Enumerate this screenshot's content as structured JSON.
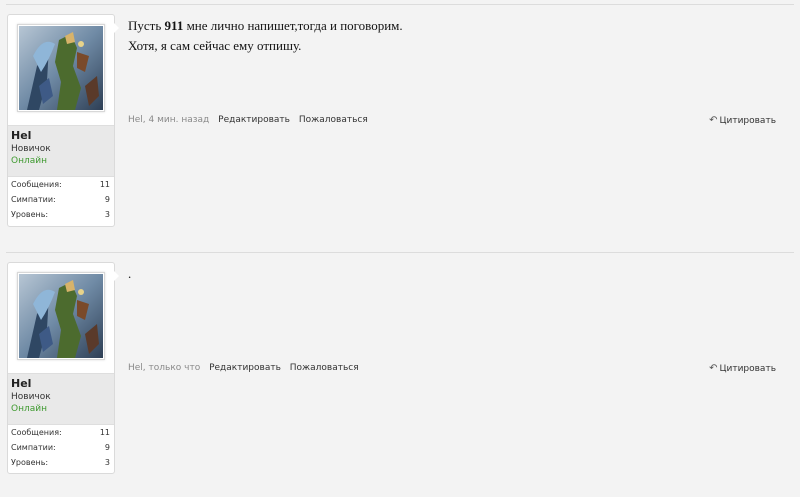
{
  "posts": [
    {
      "user": {
        "name": "Hel",
        "title": "Новичок",
        "status": "Онлайн",
        "stats": [
          {
            "label": "Сообщения:",
            "value": "11"
          },
          {
            "label": "Симпатии:",
            "value": "9"
          },
          {
            "label": "Уровень:",
            "value": "3"
          }
        ]
      },
      "message": {
        "line1_before": "Пусть ",
        "line1_bold": "911",
        "line1_after": " мне лично напишет,тогда и поговорим.",
        "line2": "Хотя, я сам сейчас ему отпишу."
      },
      "meta": {
        "author_time": "Hel, 4 мин. назад",
        "edit_label": "Редактировать",
        "report_label": "Пожаловаться",
        "quote_label": "Цитировать"
      }
    },
    {
      "user": {
        "name": "Hel",
        "title": "Новичок",
        "status": "Онлайн",
        "stats": [
          {
            "label": "Сообщения:",
            "value": "11"
          },
          {
            "label": "Симпатии:",
            "value": "9"
          },
          {
            "label": "Уровень:",
            "value": "3"
          }
        ]
      },
      "message": {
        "text": "."
      },
      "meta": {
        "author_time": "Hel, только что",
        "edit_label": "Редактировать",
        "report_label": "Пожаловаться",
        "quote_label": "Цитировать"
      }
    }
  ],
  "icons": {
    "reply": "reply-arrow-icon",
    "avatar": "fantasy-character-avatar"
  },
  "colors": {
    "online": "#3f9a30",
    "background": "#f3f3f3"
  }
}
